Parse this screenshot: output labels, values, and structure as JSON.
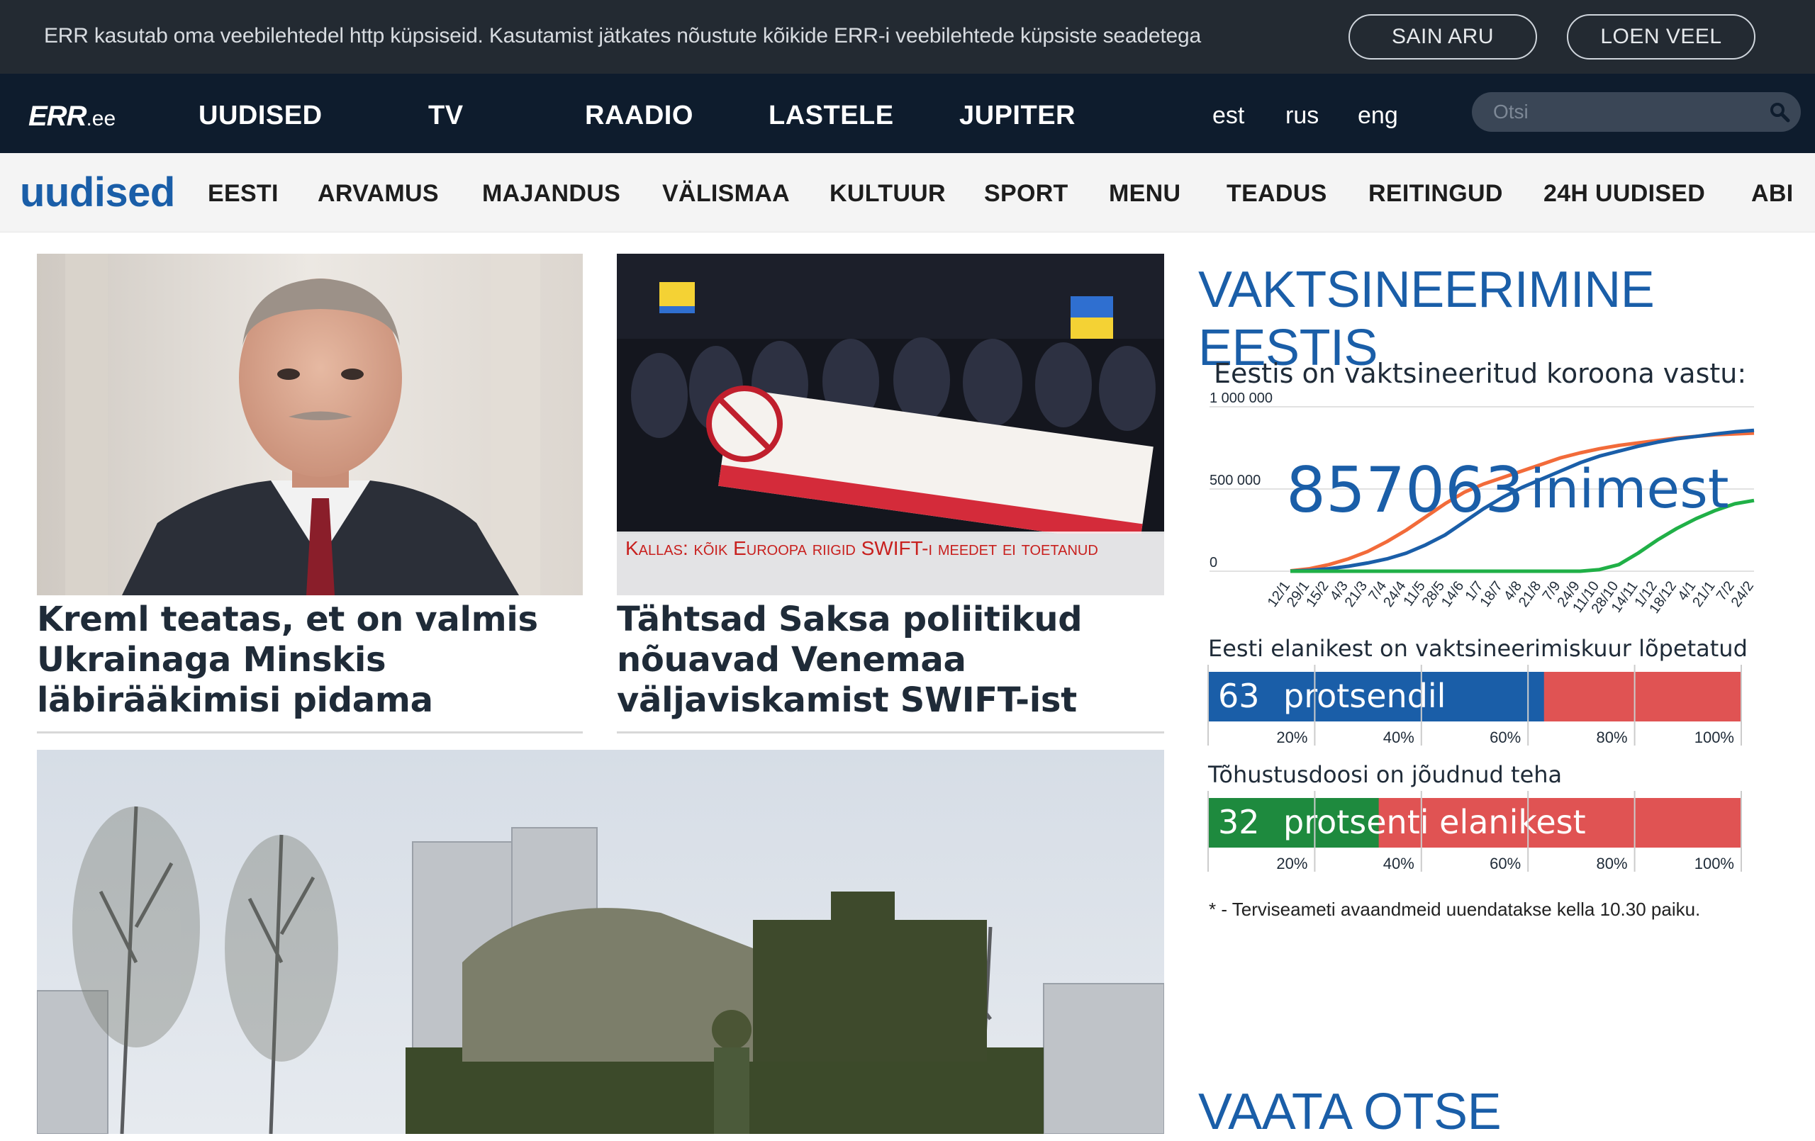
{
  "cookie": {
    "text": "ERR kasutab oma veebilehtedel http küpsiseid. Kasutamist jätkates nõustute kõikide ERR-i veebilehtede küpsiste seadetega",
    "accept_label": "SAIN ARU",
    "more_label": "LOEN VEEL"
  },
  "topnav": {
    "logo_main": "ERR",
    "logo_suffix": ".ee",
    "items": [
      "UUDISED",
      "TV",
      "RAADIO",
      "LASTELE",
      "JUPITER"
    ],
    "langs": [
      "est",
      "rus",
      "eng"
    ],
    "search_placeholder": "Otsi"
  },
  "subnav": {
    "section_logo": "uudised",
    "items": [
      "EESTI",
      "ARVAMUS",
      "MAJANDUS",
      "VÄLISMAA",
      "KULTUUR",
      "SPORT",
      "MENU",
      "TEADUS",
      "REITINGUD",
      "24H UUDISED",
      "ABI"
    ]
  },
  "articles": [
    {
      "headline": "Kreml teatas, et on valmis Ukrainaga Minskis läbirääkimisi pidama"
    },
    {
      "headline": "Tähtsad Saksa poliitikud nõuavad Venemaa väljaviskamist SWIFT-ist",
      "caption": "Kallas: kõik Euroopa riigid SWIFT-i meedet ei toetanud"
    },
    {
      "headline": ""
    }
  ],
  "sidebar": {
    "title": "VAKTSINEERIMINE EESTIS",
    "title_2": "VAATA OTSE",
    "footnote": "* - Terviseameti avaandmeid uuendatakse kella 10.30 paiku."
  },
  "colors": {
    "brand_blue": "#1a5ea8",
    "nav_dark": "#0e1c2d",
    "cookie_dark": "#232a32",
    "line_orange": "#f26b3a",
    "line_blue": "#1a5ea8",
    "line_green": "#20b047",
    "bar_blue": "#1a5ea8",
    "bar_green": "#1e8a3e",
    "bar_red": "#e05353"
  },
  "chart_data": [
    {
      "type": "line",
      "title": "Eestis on vaktsineeritud koroona vastu:",
      "big_value": "857063",
      "big_unit": "inimest",
      "ylim": [
        0,
        1000000
      ],
      "yticks": [
        "1 000 000",
        "500 000",
        "0"
      ],
      "x": [
        "12/1",
        "29/1",
        "15/2",
        "4/3",
        "21/3",
        "7/4",
        "24/4",
        "11/5",
        "28/5",
        "14/6",
        "1/7",
        "18/7",
        "4/8",
        "21/8",
        "7/9",
        "24/9",
        "11/10",
        "28/10",
        "14/11",
        "1/12",
        "18/12",
        "4/1",
        "21/1",
        "7/2",
        "24/2"
      ],
      "series": [
        {
          "values": [
            2000,
            15000,
            40000,
            75000,
            120000,
            180000,
            250000,
            330000,
            410000,
            480000,
            530000,
            570000,
            610000,
            650000,
            690000,
            720000,
            745000,
            765000,
            780000,
            795000,
            810000,
            820000,
            830000,
            835000,
            840000
          ]
        },
        {
          "values": [
            500,
            5000,
            15000,
            30000,
            50000,
            75000,
            110000,
            160000,
            220000,
            300000,
            380000,
            450000,
            510000,
            560000,
            610000,
            660000,
            700000,
            730000,
            760000,
            785000,
            805000,
            820000,
            835000,
            848000,
            857063
          ]
        },
        {
          "values": [
            0,
            0,
            0,
            0,
            0,
            0,
            0,
            0,
            0,
            0,
            0,
            0,
            0,
            0,
            0,
            0,
            10000,
            40000,
            110000,
            190000,
            260000,
            320000,
            370000,
            410000,
            430000
          ]
        }
      ]
    },
    {
      "type": "bar",
      "title": "Eesti elanikest on vaktsineerimiskuur lõpetatud",
      "value": 63,
      "label": "protsendil",
      "xticks": [
        "20%",
        "40%",
        "60%",
        "80%",
        "100%"
      ]
    },
    {
      "type": "bar",
      "title": "Tõhustusdoosi on jõudnud teha",
      "value": 32,
      "label": "protsenti elanikest",
      "xticks": [
        "20%",
        "40%",
        "60%",
        "80%",
        "100%"
      ]
    }
  ]
}
